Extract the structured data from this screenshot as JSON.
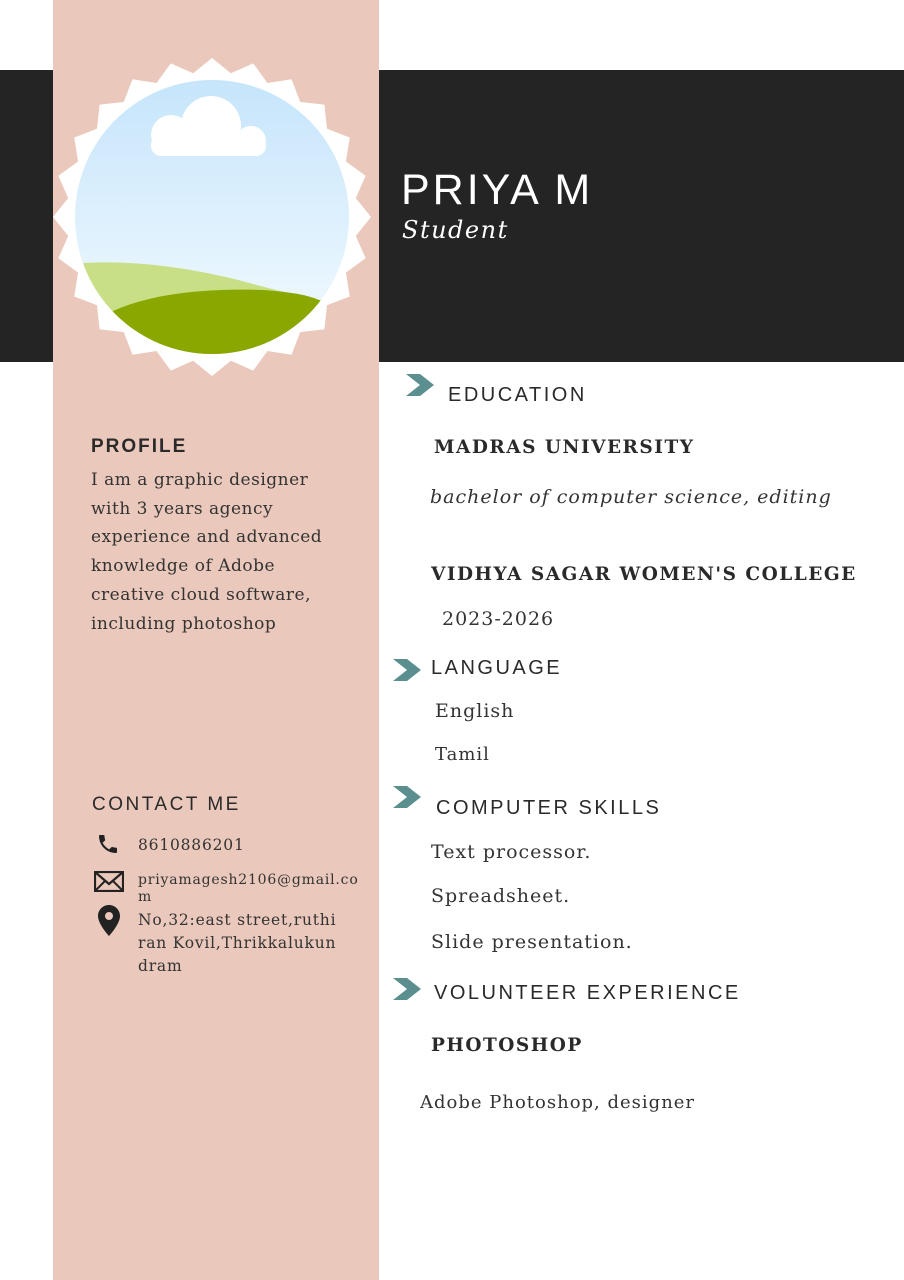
{
  "header": {
    "name": "PRIYA M",
    "role": "Student"
  },
  "profile": {
    "heading": "PROFILE",
    "text": "I am a graphic designer with 3 years agency experience and advanced knowledge of Adobe creative cloud software, including photoshop"
  },
  "contact": {
    "heading": "CONTACT ME",
    "phone": "8610886201",
    "email": "priyamagesh2106@gmail.com",
    "address": "No,32:east street,ruthiran Kovil,Thrikkalukundram"
  },
  "education": {
    "heading": "EDUCATION",
    "entries": [
      {
        "institution": "MADRAS UNIVERSITY",
        "detail": "bachelor of computer science, editing"
      },
      {
        "institution": "VIDHYA SAGAR WOMEN'S COLLEGE",
        "detail": "2023-2026"
      }
    ]
  },
  "language": {
    "heading": "LANGUAGE",
    "items": [
      "English",
      "Tamil"
    ]
  },
  "skills": {
    "heading": "COMPUTER SKILLS",
    "items": [
      "Text processor.",
      "Spreadsheet.",
      "Slide presentation."
    ]
  },
  "volunteer": {
    "heading": "VOLUNTEER EXPERIENCE",
    "title": "PHOTOSHOP",
    "detail": "Adobe Photoshop, designer"
  },
  "colors": {
    "sidebar": "#eac8bb",
    "header_band": "#242424",
    "accent_chevron": "#5b8f8f",
    "grass": "#8aa700",
    "sky": "#cfe9fb"
  },
  "icons": [
    "phone-icon",
    "envelope-icon",
    "map-pin-icon",
    "chevron-right-icon"
  ]
}
